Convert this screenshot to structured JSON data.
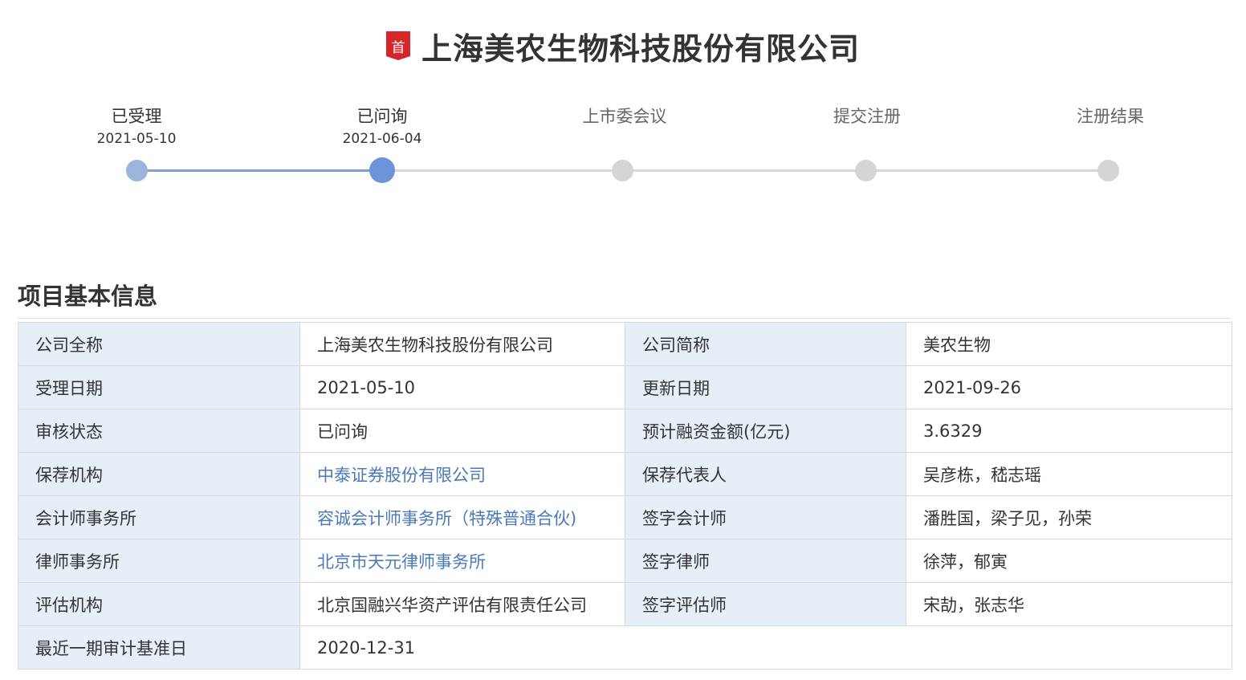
{
  "header": {
    "badge": "首",
    "title": "上海美农生物科技股份有限公司"
  },
  "timeline": {
    "current_index": 1,
    "steps": [
      {
        "label": "已受理",
        "date": "2021-05-10"
      },
      {
        "label": "已问询",
        "date": "2021-06-04"
      },
      {
        "label": "上市委会议",
        "date": ""
      },
      {
        "label": "提交注册",
        "date": ""
      },
      {
        "label": "注册结果",
        "date": ""
      }
    ]
  },
  "section": {
    "title": "项目基本信息"
  },
  "info": {
    "company_full_name_label": "公司全称",
    "company_full_name": "上海美农生物科技股份有限公司",
    "company_short_name_label": "公司简称",
    "company_short_name": "美农生物",
    "accept_date_label": "受理日期",
    "accept_date": "2021-05-10",
    "update_date_label": "更新日期",
    "update_date": "2021-09-26",
    "review_status_label": "审核状态",
    "review_status": "已问询",
    "financing_amount_label": "预计融资金额(亿元)",
    "financing_amount": "3.6329",
    "sponsor_label": "保荐机构",
    "sponsor": "中泰证券股份有限公司",
    "sponsor_rep_label": "保荐代表人",
    "sponsor_rep": "吴彦栋，嵇志瑶",
    "accounting_firm_label": "会计师事务所",
    "accounting_firm": "容诚会计师事务所（特殊普通合伙)",
    "signing_accountant_label": "签字会计师",
    "signing_accountant": "潘胜国，梁子见，孙荣",
    "law_firm_label": "律师事务所",
    "law_firm": "北京市天元律师事务所",
    "signing_lawyer_label": "签字律师",
    "signing_lawyer": "徐萍，郁寅",
    "appraisal_label": "评估机构",
    "appraisal": "北京国融兴华资产评估有限责任公司",
    "signing_appraiser_label": "签字评估师",
    "signing_appraiser": "宋劼，张志华",
    "audit_date_label": "最近一期审计基准日",
    "audit_date": "2020-12-31"
  },
  "colors": {
    "badge": "#d6262b",
    "timeline_done": "#7f9fcf",
    "timeline_current": "#6d93d8",
    "timeline_future": "#d5d5d5",
    "label_cell_bg": "#e6eef8",
    "link": "#4a7ab8"
  }
}
